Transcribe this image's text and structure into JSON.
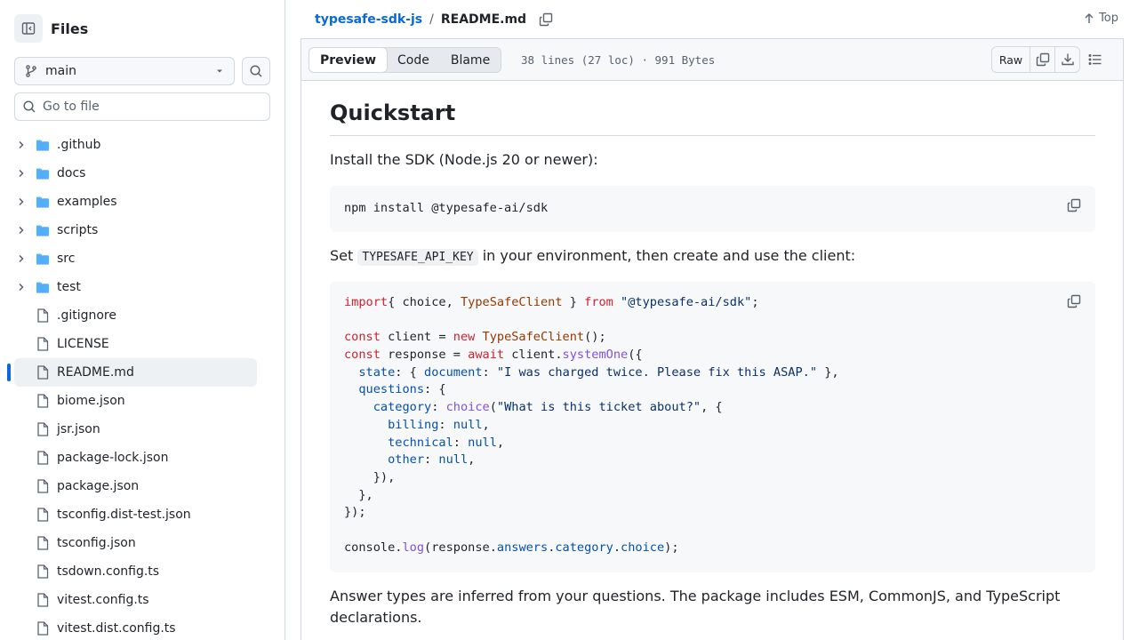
{
  "sidebar": {
    "title": "Files",
    "branch": "main",
    "goto_placeholder": "Go to file",
    "tree": [
      {
        "name": ".github",
        "kind": "dir"
      },
      {
        "name": "docs",
        "kind": "dir"
      },
      {
        "name": "examples",
        "kind": "dir"
      },
      {
        "name": "scripts",
        "kind": "dir"
      },
      {
        "name": "src",
        "kind": "dir"
      },
      {
        "name": "test",
        "kind": "dir"
      },
      {
        "name": ".gitignore",
        "kind": "file"
      },
      {
        "name": "LICENSE",
        "kind": "file"
      },
      {
        "name": "README.md",
        "kind": "file",
        "active": true
      },
      {
        "name": "biome.json",
        "kind": "file"
      },
      {
        "name": "jsr.json",
        "kind": "file"
      },
      {
        "name": "package-lock.json",
        "kind": "file"
      },
      {
        "name": "package.json",
        "kind": "file"
      },
      {
        "name": "tsconfig.dist-test.json",
        "kind": "file"
      },
      {
        "name": "tsconfig.json",
        "kind": "file"
      },
      {
        "name": "tsdown.config.ts",
        "kind": "file"
      },
      {
        "name": "vitest.config.ts",
        "kind": "file"
      },
      {
        "name": "vitest.dist.config.ts",
        "kind": "file"
      }
    ]
  },
  "breadcrumb": {
    "repo": "typesafe-sdk-js",
    "separator": "/",
    "file": "README.md",
    "top_label": "Top"
  },
  "filebar": {
    "tabs": [
      "Preview",
      "Code",
      "Blame"
    ],
    "selected_tab": "Preview",
    "meta": "38 lines (27 loc) · 991 Bytes",
    "raw_label": "Raw"
  },
  "readme": {
    "heading": "Quickstart",
    "p1": "Install the SDK (Node.js 20 or newer):",
    "install_cmd": "npm install @typesafe-ai/sdk",
    "p2_before": "Set",
    "p2_code": "TYPESAFE_API_KEY",
    "p2_after": "in your environment, then create and use the client:",
    "code_lines": [
      [
        [
          "kw",
          "import"
        ],
        [
          "",
          "{ choice, "
        ],
        [
          "cl",
          "TypeSafeClient"
        ],
        [
          "",
          " } "
        ],
        [
          "kw",
          "from"
        ],
        [
          "",
          " "
        ],
        [
          "st",
          "\"@typesafe-ai/sdk\""
        ],
        [
          "",
          ";"
        ]
      ],
      [],
      [
        [
          "kw",
          "const"
        ],
        [
          "",
          " client = "
        ],
        [
          "kw",
          "new"
        ],
        [
          "",
          " "
        ],
        [
          "cl",
          "TypeSafeClient"
        ],
        [
          "",
          "();"
        ]
      ],
      [
        [
          "kw",
          "const"
        ],
        [
          "",
          " response = "
        ],
        [
          "kw",
          "await"
        ],
        [
          "",
          " client."
        ],
        [
          "fn",
          "systemOne"
        ],
        [
          "",
          "({"
        ]
      ],
      [
        [
          "",
          "  "
        ],
        [
          "pr",
          "state"
        ],
        [
          "",
          ": { "
        ],
        [
          "pr",
          "document"
        ],
        [
          "",
          ": "
        ],
        [
          "st",
          "\"I was charged twice. Please fix this ASAP.\""
        ],
        [
          "",
          " },"
        ]
      ],
      [
        [
          "",
          "  "
        ],
        [
          "pr",
          "questions"
        ],
        [
          "",
          ": {"
        ]
      ],
      [
        [
          "",
          "    "
        ],
        [
          "pr",
          "category"
        ],
        [
          "",
          ": "
        ],
        [
          "fn",
          "choice"
        ],
        [
          "",
          "("
        ],
        [
          "st",
          "\"What is this ticket about?\""
        ],
        [
          "",
          ", {"
        ]
      ],
      [
        [
          "",
          "      "
        ],
        [
          "pr",
          "billing"
        ],
        [
          "",
          ": "
        ],
        [
          "pr",
          "null"
        ],
        [
          "",
          ","
        ]
      ],
      [
        [
          "",
          "      "
        ],
        [
          "pr",
          "technical"
        ],
        [
          "",
          ": "
        ],
        [
          "pr",
          "null"
        ],
        [
          "",
          ","
        ]
      ],
      [
        [
          "",
          "      "
        ],
        [
          "pr",
          "other"
        ],
        [
          "",
          ": "
        ],
        [
          "pr",
          "null"
        ],
        [
          "",
          ","
        ]
      ],
      [
        [
          "",
          "    }),"
        ]
      ],
      [
        [
          "",
          "  },"
        ]
      ],
      [
        [
          "",
          "});"
        ]
      ],
      [],
      [
        [
          "",
          "console."
        ],
        [
          "fn",
          "log"
        ],
        [
          "",
          "(response."
        ],
        [
          "pr",
          "answers"
        ],
        [
          "",
          "."
        ],
        [
          "pr",
          "category"
        ],
        [
          "",
          "."
        ],
        [
          "pr",
          "choice"
        ],
        [
          "",
          ");"
        ]
      ]
    ],
    "p3": "Answer types are inferred from your questions. The package includes ESM, CommonJS, and TypeScript declarations."
  }
}
